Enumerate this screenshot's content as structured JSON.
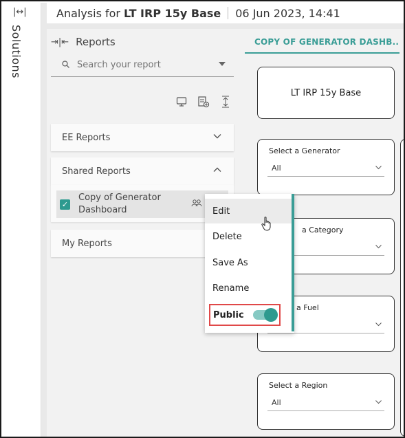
{
  "rail": {
    "title": "Solutions",
    "expand_icon": "expand-horizontal-icon"
  },
  "header": {
    "prefix": "Analysis for",
    "analysis_name": "LT IRP 15y Base",
    "timestamp": "06 Jun 2023, 14:41"
  },
  "reports_panel": {
    "title": "Reports",
    "search_placeholder": "Search your report",
    "tools": [
      "presentation-icon",
      "add-report-icon",
      "expand-vertical-icon"
    ],
    "sections": [
      {
        "label": "EE Reports",
        "expanded": false
      },
      {
        "label": "Shared Reports",
        "expanded": true,
        "items": [
          {
            "name": "Copy of Generator Dashboard",
            "checked": true
          }
        ]
      },
      {
        "label": "My Reports",
        "expanded": false
      }
    ]
  },
  "context_menu": {
    "items": [
      "Edit",
      "Delete",
      "Save As",
      "Rename"
    ],
    "public_label": "Public",
    "public_on": true
  },
  "dashboard": {
    "tab_label": "COPY OF GENERATOR DASHB...",
    "title_card": "LT IRP 15y Base",
    "filters": [
      {
        "label": "Select a Generator",
        "value": "All"
      },
      {
        "label": "a Category",
        "value": ""
      },
      {
        "label": "a Fuel",
        "value": ""
      },
      {
        "label": "Select a Region",
        "value": "All"
      }
    ]
  },
  "colors": {
    "accent": "#3a9d96",
    "highlight_border": "#e04848"
  }
}
